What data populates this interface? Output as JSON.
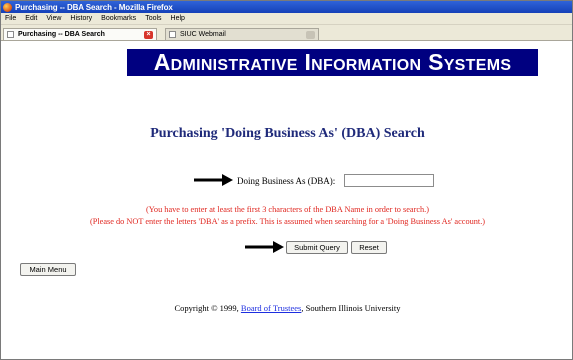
{
  "window": {
    "title": "Purchasing -- DBA Search - Mozilla Firefox"
  },
  "menu": [
    "File",
    "Edit",
    "View",
    "History",
    "Bookmarks",
    "Tools",
    "Help"
  ],
  "tabs": [
    {
      "label": "Purchasing -- DBA Search",
      "active": true
    },
    {
      "label": "SIUC Webmail",
      "active": false
    }
  ],
  "banner": {
    "text": "Administrative Information Systems"
  },
  "page": {
    "heading": "Purchasing 'Doing Business As' (DBA) Search",
    "field_label": "Doing Business As (DBA):",
    "field_value": "",
    "note1": "(You have to enter at least the first 3 characters of the DBA Name in order to search.)",
    "note2": "(Please do NOT enter the letters 'DBA' as a prefix. This is assumed when searching for a 'Doing Business As' account.)",
    "submit_label": "Submit Query",
    "reset_label": "Reset",
    "main_menu_label": "Main Menu"
  },
  "footer": {
    "prefix": "Copyright © 1999, ",
    "link": "Board of Trustees",
    "suffix": ", Southern Illinois University"
  },
  "colors": {
    "banner": "#000080",
    "heading": "#1f2a7a",
    "note": "#e0261f",
    "link": "#1d2ee0"
  }
}
